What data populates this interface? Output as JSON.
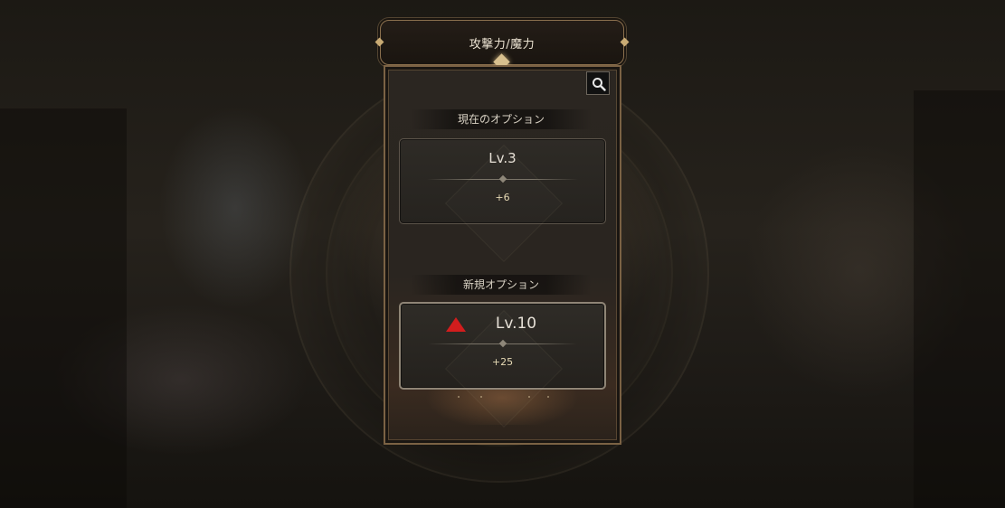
{
  "window": {
    "title": "攻撃力/魔力"
  },
  "panel": {
    "search_icon": "search-icon",
    "current": {
      "label": "現在のオプション",
      "level": "Lv.3",
      "value": "+6"
    },
    "new": {
      "label": "新規オプション",
      "indicator_icon": "up-arrow-icon",
      "indicator_color": "#d21d1d",
      "level": "Lv.10",
      "value": "+25"
    }
  }
}
